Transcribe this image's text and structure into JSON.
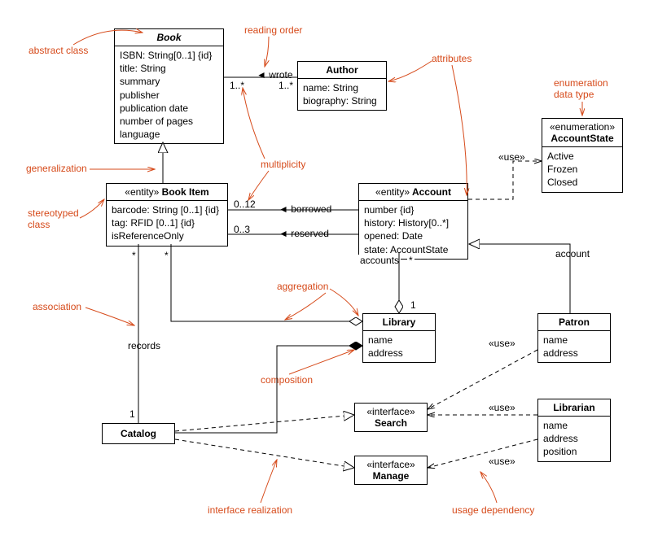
{
  "classes": {
    "book": {
      "title": "Book",
      "attrs": [
        "ISBN: String[0..1] {id}",
        "title: String",
        "summary",
        "publisher",
        "publication date",
        "number of pages",
        "language"
      ]
    },
    "author": {
      "title": "Author",
      "attrs": [
        "name: String",
        "biography: String"
      ]
    },
    "accountState": {
      "stereo": "«enumeration»",
      "title": "AccountState",
      "attrs": [
        "Active",
        "Frozen",
        "Closed"
      ]
    },
    "bookItem": {
      "stereo": "«entity»",
      "title": "Book Item",
      "attrs": [
        "barcode: String [0..1] {id}",
        "tag: RFID [0..1] {id}",
        "isReferenceOnly"
      ]
    },
    "account": {
      "stereo": "«entity»",
      "title": "Account",
      "attrs": [
        "number {id}",
        "history: History[0..*]",
        "opened: Date",
        "state: AccountState"
      ]
    },
    "library": {
      "title": "Library",
      "attrs": [
        "name",
        "address"
      ]
    },
    "patron": {
      "title": "Patron",
      "attrs": [
        "name",
        "address"
      ]
    },
    "catalog": {
      "title": "Catalog"
    },
    "search": {
      "stereo": "«interface»",
      "title": "Search"
    },
    "manage": {
      "stereo": "«interface»",
      "title": "Manage"
    },
    "librarian": {
      "title": "Librarian",
      "attrs": [
        "name",
        "address",
        "position"
      ]
    }
  },
  "labels": {
    "wrote": "wrote",
    "author_mult_left": "1..*",
    "author_mult_right": "1..*",
    "borrowed": "borrowed",
    "borrowed_mult": "0..12",
    "reserved": "reserved",
    "reserved_mult": "0..3",
    "records": "records",
    "accounts": "accounts",
    "account_role": "account",
    "star1": "*",
    "star2": "*",
    "star3": "*",
    "one_cat": "1",
    "one_lib": "1",
    "use1": "«use»",
    "use2": "«use»",
    "use3": "«use»",
    "use4": "«use»"
  },
  "annotations": {
    "abstract_class": "abstract class",
    "reading_order": "reading order",
    "attributes": "attributes",
    "enumeration": "enumeration\ndata type",
    "generalization": "generalization",
    "stereotyped": "stereotyped\nclass",
    "multiplicity": "multiplicity",
    "association": "association",
    "aggregation": "aggregation",
    "composition": "composition",
    "interface_realization": "interface realization",
    "usage_dependency": "usage dependency"
  },
  "chart_data": {
    "type": "uml-class-diagram",
    "classes": [
      {
        "name": "Book",
        "abstract": true,
        "attributes": [
          "ISBN: String[0..1] {id}",
          "title: String",
          "summary",
          "publisher",
          "publication date",
          "number of pages",
          "language"
        ]
      },
      {
        "name": "Author",
        "attributes": [
          "name: String",
          "biography: String"
        ]
      },
      {
        "name": "AccountState",
        "stereotype": "enumeration",
        "literals": [
          "Active",
          "Frozen",
          "Closed"
        ]
      },
      {
        "name": "Book Item",
        "stereotype": "entity",
        "attributes": [
          "barcode: String [0..1] {id}",
          "tag: RFID [0..1] {id}",
          "isReferenceOnly"
        ]
      },
      {
        "name": "Account",
        "stereotype": "entity",
        "attributes": [
          "number {id}",
          "history: History[0..*]",
          "opened: Date",
          "state: AccountState"
        ]
      },
      {
        "name": "Library",
        "attributes": [
          "name",
          "address"
        ]
      },
      {
        "name": "Patron",
        "attributes": [
          "name",
          "address"
        ]
      },
      {
        "name": "Catalog"
      },
      {
        "name": "Search",
        "stereotype": "interface"
      },
      {
        "name": "Manage",
        "stereotype": "interface"
      },
      {
        "name": "Librarian",
        "attributes": [
          "name",
          "address",
          "position"
        ]
      }
    ],
    "relationships": [
      {
        "type": "association",
        "from": "Book",
        "to": "Author",
        "name": "wrote",
        "from_mult": "1..*",
        "to_mult": "1..*",
        "direction": "to->from"
      },
      {
        "type": "generalization",
        "from": "Book Item",
        "to": "Book"
      },
      {
        "type": "association",
        "from": "Book Item",
        "to": "Account",
        "name": "borrowed",
        "from_mult": "0..12"
      },
      {
        "type": "association",
        "from": "Book Item",
        "to": "Account",
        "name": "reserved",
        "from_mult": "0..3"
      },
      {
        "type": "aggregation",
        "whole": "Library",
        "part": "Book Item",
        "part_mult": "*"
      },
      {
        "type": "aggregation",
        "whole": "Library",
        "part": "Account",
        "part_role": "accounts",
        "part_mult": "*"
      },
      {
        "type": "composition",
        "whole": "Library",
        "part": "Catalog",
        "part_mult": "1"
      },
      {
        "type": "association",
        "from": "Book Item",
        "to": "Catalog",
        "name": "records",
        "from_mult": "*"
      },
      {
        "type": "generalization",
        "from": "Patron",
        "to": "Account",
        "role": "account"
      },
      {
        "type": "dependency",
        "stereotype": "use",
        "from": "Account",
        "to": "AccountState"
      },
      {
        "type": "dependency",
        "stereotype": "use",
        "from": "Patron",
        "to": "Search"
      },
      {
        "type": "dependency",
        "stereotype": "use",
        "from": "Librarian",
        "to": "Search"
      },
      {
        "type": "dependency",
        "stereotype": "use",
        "from": "Librarian",
        "to": "Manage"
      },
      {
        "type": "realization",
        "from": "Catalog",
        "to": "Search"
      },
      {
        "type": "realization",
        "from": "Catalog",
        "to": "Manage"
      }
    ],
    "annotations": [
      "abstract class",
      "reading order",
      "attributes",
      "enumeration data type",
      "generalization",
      "stereotyped class",
      "multiplicity",
      "association",
      "aggregation",
      "composition",
      "interface realization",
      "usage dependency"
    ]
  }
}
